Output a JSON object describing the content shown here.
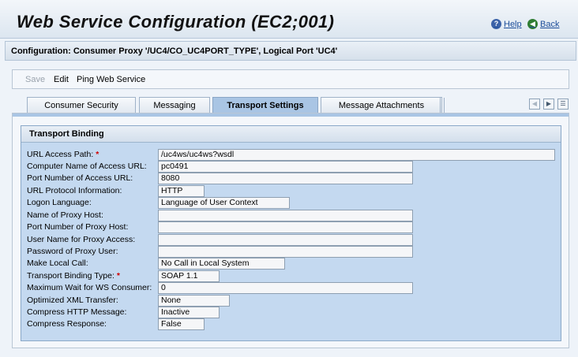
{
  "header": {
    "title": "Web Service Configuration (EC2;001)",
    "help": "Help",
    "back": "Back"
  },
  "config_bar": {
    "text": "Configuration: Consumer Proxy '/UC4/CO_UC4PORT_TYPE', Logical Port 'UC4'"
  },
  "toolbar": {
    "save": "Save",
    "edit": "Edit",
    "ping": "Ping Web Service"
  },
  "tabs": [
    {
      "label": "Consumer Security",
      "active": false
    },
    {
      "label": "Messaging",
      "active": false
    },
    {
      "label": "Transport Settings",
      "active": true
    },
    {
      "label": "Message Attachments",
      "active": false
    }
  ],
  "icons": {
    "help": "help-icon",
    "back": "back-icon",
    "first": "first-page-icon",
    "next": "next-page-icon",
    "list": "tab-list-icon"
  },
  "group": {
    "title": "Transport Binding"
  },
  "fields": [
    {
      "label": "URL Access Path:",
      "required": true,
      "value": "/uc4ws/uc4ws?wsdl"
    },
    {
      "label": "Computer Name of Access URL:",
      "required": false,
      "value": "pc0491"
    },
    {
      "label": "Port Number of Access URL:",
      "required": false,
      "value": "8080"
    },
    {
      "label": "URL Protocol Information:",
      "required": false,
      "value": "HTTP"
    },
    {
      "label": "Logon Language:",
      "required": false,
      "value": "Language of User Context"
    },
    {
      "label": "Name of Proxy Host:",
      "required": false,
      "value": ""
    },
    {
      "label": "Port Number of Proxy Host:",
      "required": false,
      "value": ""
    },
    {
      "label": "User Name for Proxy Access:",
      "required": false,
      "value": ""
    },
    {
      "label": "Password of Proxy User:",
      "required": false,
      "value": ""
    },
    {
      "label": "Make Local Call:",
      "required": false,
      "value": "No Call in Local System"
    },
    {
      "label": "Transport Binding Type:",
      "required": true,
      "value": "SOAP 1.1"
    },
    {
      "label": "Maximum Wait for WS Consumer:",
      "required": false,
      "value": "0"
    },
    {
      "label": "Optimized XML Transfer:",
      "required": false,
      "value": "None"
    },
    {
      "label": "Compress HTTP Message:",
      "required": false,
      "value": "Inactive"
    },
    {
      "label": "Compress Response:",
      "required": false,
      "value": "False"
    }
  ],
  "colors": {
    "accent": "#a9c5e4",
    "group_bg": "#c4d9f0",
    "required": "#d00000"
  }
}
